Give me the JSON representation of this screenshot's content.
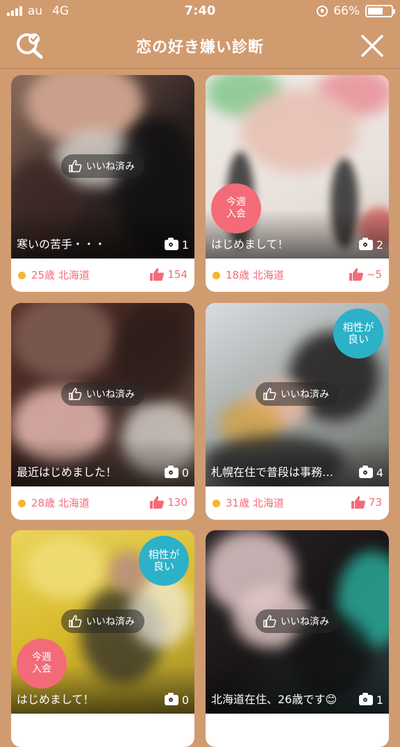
{
  "status_bar": {
    "carrier": "au",
    "network": "4G",
    "time": "7:40",
    "battery": "66%",
    "battery_level": 0.66
  },
  "header": {
    "title": "恋の好き嫌い診断",
    "search_icon": "search-check-icon",
    "close_icon": "close-icon"
  },
  "colors": {
    "background": "#d19b70",
    "accent": "#f36b78",
    "badge_red": "#f36b78",
    "badge_teal": "#2cb1c9",
    "online_dot": "#f5b62a"
  },
  "cards": [
    {
      "caption": "寒いの苦手・・・",
      "photos": "1",
      "age": "25歳",
      "area": "北海道",
      "likes": "154",
      "like_label": "いいね済み",
      "badge_new": "",
      "badge_match": ""
    },
    {
      "caption": "はじめまして！",
      "photos": "2",
      "age": "18歳",
      "area": "北海道",
      "likes": "~5",
      "like_label": "",
      "badge_new": "今週\n入会",
      "badge_match": ""
    },
    {
      "caption": "最近はじめました！",
      "photos": "0",
      "age": "28歳",
      "area": "北海道",
      "likes": "130",
      "like_label": "いいね済み",
      "badge_new": "",
      "badge_match": ""
    },
    {
      "caption": "札幌在住で普段は事務…",
      "photos": "4",
      "age": "31歳",
      "area": "北海道",
      "likes": "73",
      "like_label": "いいね済み",
      "badge_new": "",
      "badge_match": "相性が\n良い"
    },
    {
      "caption": "はじめまして！",
      "photos": "0",
      "age": "",
      "area": "",
      "likes": "",
      "like_label": "いいね済み",
      "badge_new": "今週\n入会",
      "badge_match": "相性が\n良い"
    },
    {
      "caption": "北海道在住、26歳です😊",
      "photos": "1",
      "age": "",
      "area": "",
      "likes": "",
      "like_label": "いいね済み",
      "badge_new": "",
      "badge_match": ""
    }
  ]
}
